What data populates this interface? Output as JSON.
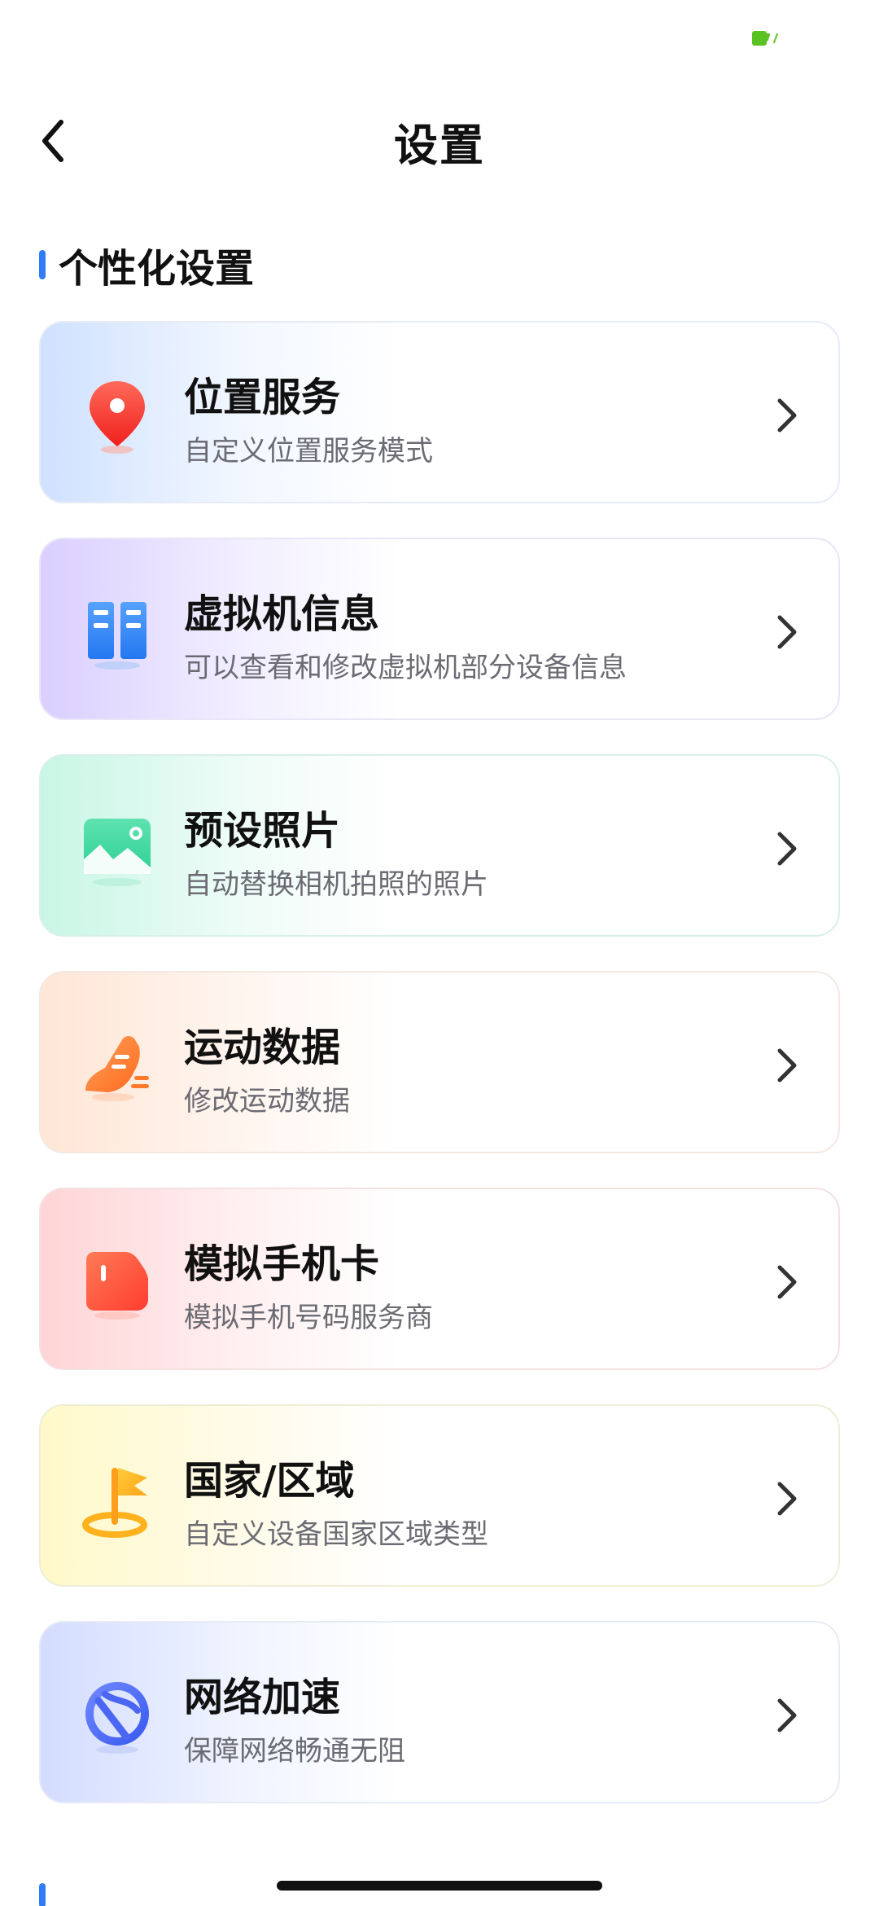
{
  "header": {
    "title": "设置"
  },
  "section": {
    "title": "个性化设置"
  },
  "cards": [
    {
      "title": "位置服务",
      "subtitle": "自定义位置服务模式",
      "icon": "location-pin-icon"
    },
    {
      "title": "虚拟机信息",
      "subtitle": "可以查看和修改虚拟机部分设备信息",
      "icon": "device-info-icon"
    },
    {
      "title": "预设照片",
      "subtitle": "自动替换相机拍照的照片",
      "icon": "photo-icon"
    },
    {
      "title": "运动数据",
      "subtitle": "修改运动数据",
      "icon": "running-shoe-icon"
    },
    {
      "title": "模拟手机卡",
      "subtitle": "模拟手机号码服务商",
      "icon": "sim-card-icon"
    },
    {
      "title": "国家/区域",
      "subtitle": "自定义设备国家区域类型",
      "icon": "country-flag-icon"
    },
    {
      "title": "网络加速",
      "subtitle": "保障网络畅通无阻",
      "icon": "network-accelerate-icon"
    }
  ],
  "colors": {
    "accent": "#2f7cf6"
  }
}
